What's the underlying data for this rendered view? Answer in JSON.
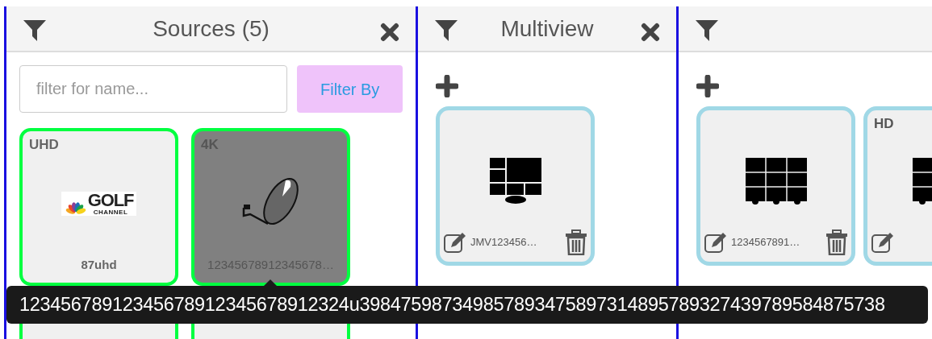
{
  "panels": [
    {
      "kind": "sources",
      "title": "Sources (5)",
      "closable": true,
      "filter": {
        "placeholder": "filter for name...",
        "button": "Filter By"
      },
      "cards": [
        {
          "format": "UHD",
          "kind": "channel-logo",
          "logo_text": "GOLF",
          "logo_subtext": "CHANNEL",
          "name": "87uhd",
          "selected": false
        },
        {
          "format": "4K",
          "kind": "satellite-dish",
          "name": "12345678912345678…",
          "selected": true
        },
        {
          "kind": "blank",
          "selected": false
        },
        {
          "kind": "blank",
          "selected": false
        }
      ]
    },
    {
      "kind": "layouts",
      "title": "Multiview",
      "closable": true,
      "cards": [
        {
          "kind": "monitor",
          "name": "JMV123456…",
          "deletable": true
        }
      ]
    },
    {
      "kind": "layouts",
      "closable": false,
      "cards": [
        {
          "kind": "video-wall",
          "name": "1234567891…",
          "deletable": true
        },
        {
          "format": "HD",
          "kind": "video-wall",
          "deletable": false
        }
      ]
    }
  ],
  "tooltip": {
    "text": "12345678912345678912345678912324u398475987349857893475897314895789327439789584875738"
  }
}
